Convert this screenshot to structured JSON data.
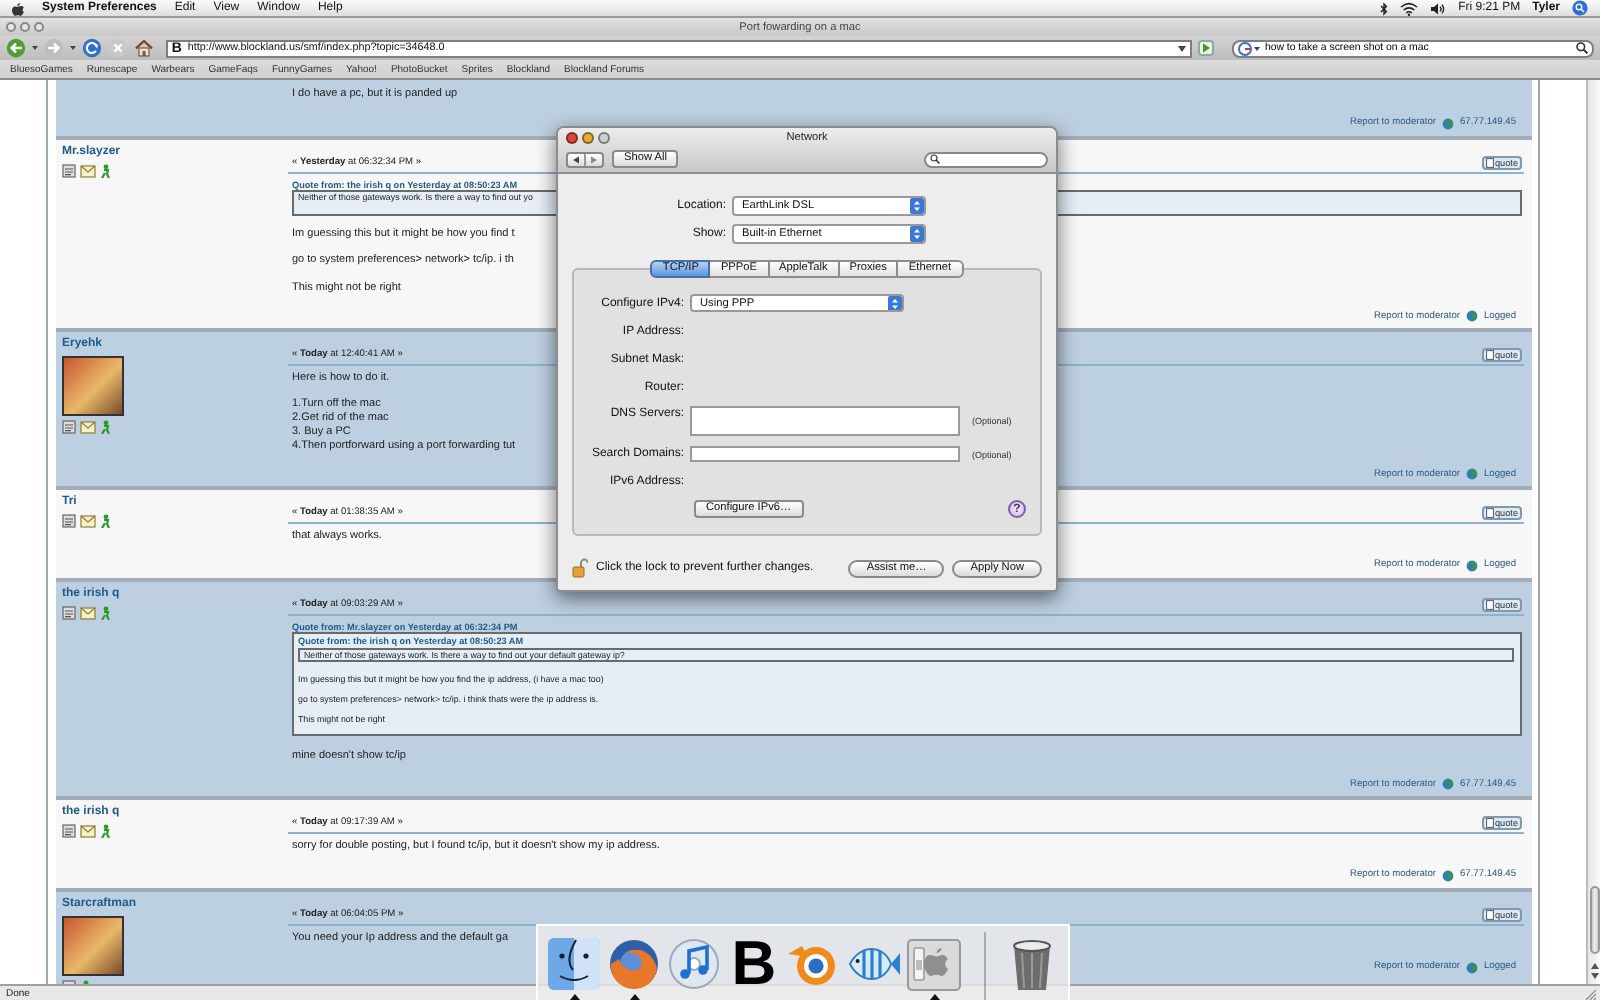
{
  "menubar": {
    "app": "System Preferences",
    "menus": [
      "Edit",
      "View",
      "Window",
      "Help"
    ],
    "clock": "Fri 9:21 PM",
    "user": "Tyler"
  },
  "browser": {
    "title": "Port fowarding on a mac",
    "favicon": "B",
    "url": "http://www.blockland.us/smf/index.php?topic=34648.0",
    "search": "how to take a screen shot on a mac",
    "bookmarks": [
      "BluesoGames",
      "Runescape",
      "Warbears",
      "GameFaqs",
      "FunnyGames",
      "Yahoo!",
      "PhotoBucket",
      "Sprites",
      "Blockland",
      "Blockland Forums"
    ],
    "status": "Done"
  },
  "posts": [
    {
      "body": [
        {
          "kind": "para",
          "lines": [
            "I do have a pc, but it is panded up"
          ]
        }
      ],
      "report": "Report to moderator",
      "footer_note": "67.77.149.45"
    },
    {
      "author": "Mr.slayzer",
      "avatar": false,
      "email_icon": true,
      "date": "« **Yesterday** at 06:32:34 PM »",
      "quote_button": "quote",
      "body": [
        {
          "kind": "quote",
          "header": "Quote from: the irish q on Yesterday at 08:50:23 AM",
          "body": [
            {
              "kind": "para",
              "lines": [
                "Neither of those gateways work. Is there a way to find out yo"
              ]
            }
          ]
        },
        {
          "kind": "para",
          "lines": [
            "Im guessing this but it might be how you find t"
          ]
        },
        {
          "kind": "para",
          "lines": [
            "go to system preferences> network> tc/ip. i th"
          ]
        },
        {
          "kind": "para",
          "lines": [
            "This might not be right"
          ]
        }
      ],
      "report": "Report to moderator",
      "footer_note": "Logged"
    },
    {
      "author": "Eryehk",
      "avatar": true,
      "email_icon": true,
      "date": "« **Today** at 12:40:41 AM »",
      "quote_button": "quote",
      "body": [
        {
          "kind": "para",
          "lines": [
            "Here is how to do it."
          ]
        },
        {
          "kind": "para",
          "lines": [
            "1.Turn off the mac",
            "2.Get rid of the mac",
            "3. Buy a PC",
            "4.Then portforward using a port forwarding tut"
          ]
        }
      ],
      "report": "Report to moderator",
      "footer_note": "Logged"
    },
    {
      "author": "Tri",
      "avatar": false,
      "email_icon": true,
      "date": "« **Today** at 01:38:35 AM »",
      "quote_button": "quote",
      "body": [
        {
          "kind": "para",
          "lines": [
            "that always works."
          ]
        }
      ],
      "report": "Report to moderator",
      "footer_note": "Logged"
    },
    {
      "author": "the irish q",
      "avatar": false,
      "email_icon": true,
      "date": "« **Today** at 09:03:29 AM »",
      "quote_button": "quote",
      "body": [
        {
          "kind": "quote",
          "header": "Quote from: Mr.slayzer on Yesterday at 06:32:34 PM",
          "body": [
            {
              "kind": "quote",
              "header": "Quote from: the irish q on Yesterday at 08:50:23 AM",
              "body": [
                {
                  "kind": "para",
                  "lines": [
                    "Neither of those gateways work. Is there a way to find out your default gateway ip?"
                  ]
                }
              ]
            },
            {
              "kind": "para",
              "lines": [
                "Im guessing this but it might be how you find the ip address, (i have a mac too)"
              ]
            },
            {
              "kind": "para",
              "lines": [
                "go to system preferences> network> tc/ip. i think thats were the ip address is."
              ]
            },
            {
              "kind": "para",
              "lines": [
                "This might not be right"
              ]
            }
          ]
        },
        {
          "kind": "para",
          "lines": [
            "mine doesn't show tc/ip"
          ]
        }
      ],
      "report": "Report to moderator",
      "footer_note": "67.77.149.45"
    },
    {
      "author": "the irish q",
      "avatar": false,
      "email_icon": true,
      "date": "« **Today** at 09:17:39 AM »",
      "quote_button": "quote",
      "body": [
        {
          "kind": "para",
          "lines": [
            "sorry for double posting, but I found tc/ip, but it doesn't show my ip address."
          ]
        }
      ],
      "report": "Report to moderator",
      "footer_note": "67.77.149.45"
    },
    {
      "author": "Starcraftman",
      "avatar": true,
      "email_icon": false,
      "date": "« **Today** at 06:04:05 PM »",
      "quote_button": "quote",
      "body": [
        {
          "kind": "para",
          "lines": [
            "You need your Ip address and the default ga"
          ]
        }
      ],
      "report": "Report to moderator",
      "footer_note": "Logged"
    }
  ],
  "network": {
    "title": "Network",
    "show_all": "Show All",
    "location_label": "Location:",
    "location": "EarthLink DSL",
    "show_label": "Show:",
    "show": "Built-in Ethernet",
    "tabs": [
      {
        "label": "TCP/IP",
        "selected": true
      },
      {
        "label": "PPPoE",
        "selected": false
      },
      {
        "label": "AppleTalk",
        "selected": false
      },
      {
        "label": "Proxies",
        "selected": false
      },
      {
        "label": "Ethernet",
        "selected": false
      }
    ],
    "rows": [
      {
        "kind": "popup",
        "label": "Configure IPv4:",
        "value": "Using PPP"
      },
      {
        "kind": "static",
        "label": "IP Address:"
      },
      {
        "kind": "static",
        "label": "Subnet Mask:"
      },
      {
        "kind": "static",
        "label": "Router:"
      },
      {
        "kind": "textarea",
        "label": "DNS Servers:",
        "note": "(Optional)"
      },
      {
        "kind": "field",
        "label": "Search Domains:",
        "note": "(Optional)"
      },
      {
        "kind": "static",
        "label": "IPv6 Address:"
      }
    ],
    "configure_button": "Configure IPv6…",
    "help_button": "?",
    "lock_text": "Click the lock to prevent further changes.",
    "buttons": [
      "Assist me…",
      "Apply Now"
    ]
  },
  "dock": [
    {
      "kind": "finder",
      "running": true
    },
    {
      "kind": "firefox",
      "running": true
    },
    {
      "kind": "itunes",
      "running": false
    },
    {
      "kind": "letter",
      "label": "B",
      "running": false
    },
    {
      "kind": "blender",
      "running": false
    },
    {
      "kind": "fish",
      "running": false
    },
    {
      "kind": "sysprefs",
      "running": true
    },
    {
      "kind": "trash",
      "running": false
    }
  ]
}
